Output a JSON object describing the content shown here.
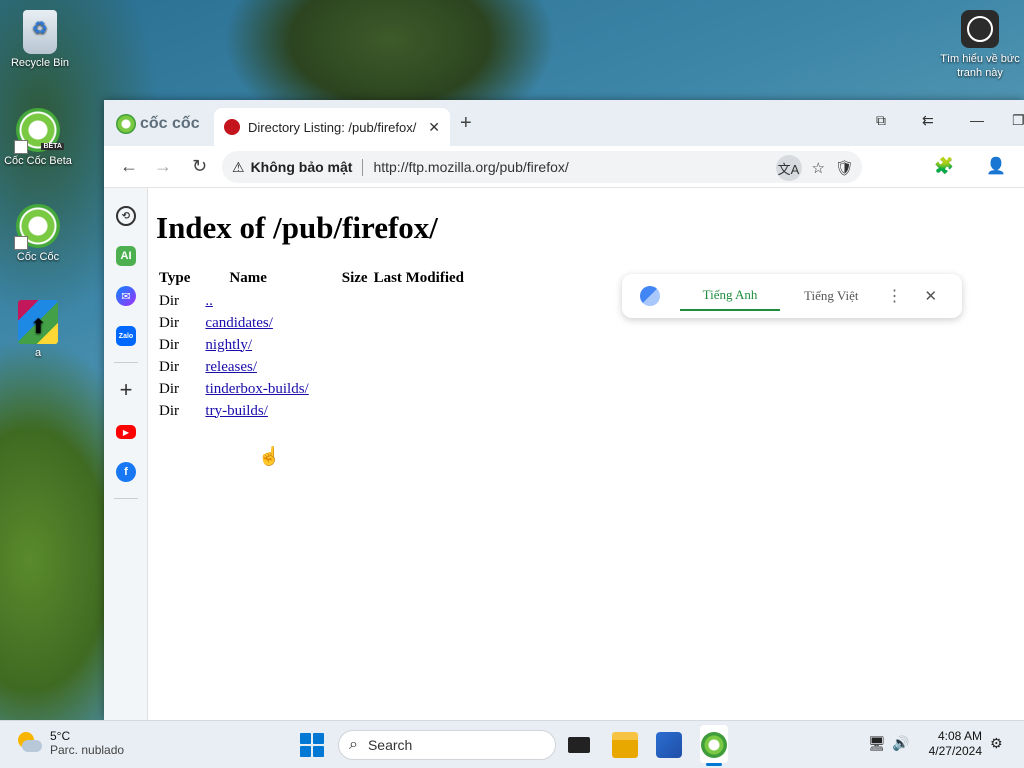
{
  "desktop": {
    "icons": [
      {
        "label": "Recycle Bin"
      },
      {
        "label": "Cốc Cốc Beta",
        "badge": "BETA"
      },
      {
        "label": "Cốc Cốc"
      },
      {
        "label": "a"
      }
    ],
    "learn_more": {
      "label": "Tìm hiểu về bức tranh này"
    }
  },
  "browser": {
    "brand": "cốc cốc",
    "tab": {
      "title": "Directory Listing: /pub/firefox/",
      "close": "✕"
    },
    "new_tab": "+",
    "window_controls": {
      "snap": "⧉",
      "back_layout": "⇇",
      "minimize": "—",
      "restore": "❐"
    },
    "nav": {
      "back": "←",
      "forward": "→",
      "reload": "↻"
    },
    "security": {
      "icon": "⚠",
      "label": "Không bảo mật"
    },
    "url": "http://ftp.mozilla.org/pub/firefox/",
    "omnibox_icons": {
      "translate": "文A",
      "bookmark": "☆",
      "shield": "🛡"
    },
    "toolbar_icons": {
      "extensions": "🧩",
      "profile": "👤"
    },
    "sidebar": [
      {
        "name": "history",
        "glyph": "⟲"
      },
      {
        "name": "ai",
        "glyph": "AI"
      },
      {
        "name": "messenger",
        "glyph": "✉"
      },
      {
        "name": "zalo",
        "glyph": "Zalo"
      },
      {
        "name": "add",
        "glyph": "+"
      },
      {
        "name": "youtube",
        "glyph": "▶"
      },
      {
        "name": "facebook",
        "glyph": "f"
      }
    ],
    "translate_popup": {
      "lang_source": "Tiếng Anh",
      "lang_target": "Tiếng Việt",
      "more": "⋮",
      "close": "✕"
    },
    "page": {
      "heading": "Index of /pub/firefox/",
      "columns": [
        "Type",
        "Name",
        "Size",
        "Last Modified"
      ],
      "rows": [
        {
          "type": "Dir",
          "name": ".."
        },
        {
          "type": "Dir",
          "name": "candidates/"
        },
        {
          "type": "Dir",
          "name": "nightly/"
        },
        {
          "type": "Dir",
          "name": "releases/"
        },
        {
          "type": "Dir",
          "name": "tinderbox-builds/"
        },
        {
          "type": "Dir",
          "name": "try-builds/"
        }
      ]
    }
  },
  "taskbar": {
    "weather": {
      "temp": "5°C",
      "desc": "Parc. nublado"
    },
    "search_placeholder": "Search",
    "tray": {
      "network": "🖥",
      "volume": "🔊"
    },
    "clock": {
      "time": "4:08 AM",
      "date": "4/27/2024"
    }
  }
}
